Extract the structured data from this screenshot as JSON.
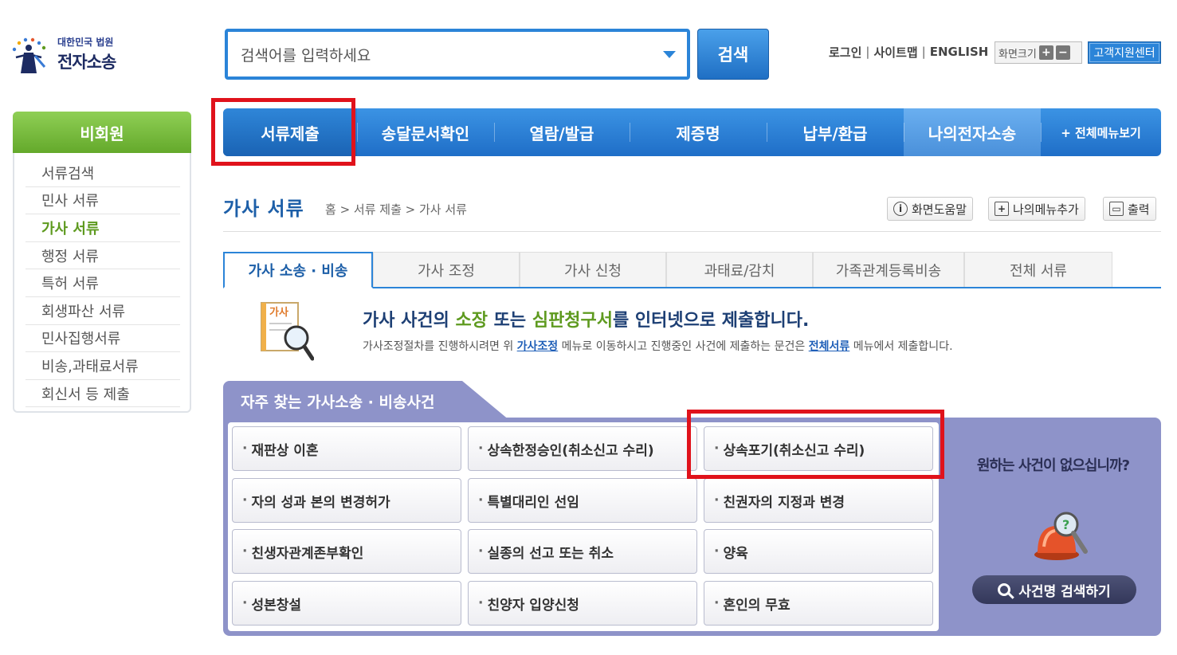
{
  "logo": {
    "sub": "대한민국 법원",
    "main": "전자소송"
  },
  "search": {
    "placeholder": "검색어를 입력하세요",
    "button": "검색"
  },
  "util": {
    "login": "로그인",
    "sitemap": "사이트맵",
    "english": "ENGLISH",
    "zoom": "화면크기",
    "zoom_in": "+",
    "zoom_out": "−",
    "support": "고객지원센터"
  },
  "sidebar": {
    "header": "비회원",
    "items": [
      {
        "label": "서류검색"
      },
      {
        "label": "민사 서류"
      },
      {
        "label": "가사 서류"
      },
      {
        "label": "행정 서류"
      },
      {
        "label": "특허 서류"
      },
      {
        "label": "회생파산 서류"
      },
      {
        "label": "민사집행서류"
      },
      {
        "label": "비송,과태료서류"
      },
      {
        "label": "회신서 등 제출"
      }
    ],
    "active_index": 2
  },
  "gnb": {
    "items": [
      {
        "label": "서류제출"
      },
      {
        "label": "송달문서확인"
      },
      {
        "label": "열람/발급"
      },
      {
        "label": "제증명"
      },
      {
        "label": "납부/환급"
      },
      {
        "label": "나의전자소송"
      },
      {
        "label": "+ 전체메뉴보기"
      }
    ]
  },
  "page": {
    "title": "가사 서류",
    "breadcrumb": "홈 > 서류 제출 > 가사 서류",
    "help": "화면도움말",
    "add_menu": "나의메뉴추가",
    "print": "출력"
  },
  "tabs": [
    {
      "label": "가사 소송 · 비송"
    },
    {
      "label": "가사 조정"
    },
    {
      "label": "가사 신청"
    },
    {
      "label": "과태료/감치"
    },
    {
      "label": "가족관계등록비송"
    },
    {
      "label": "전체 서류"
    }
  ],
  "intro": {
    "icon_label": "가사",
    "title_1": "가사 사건의 ",
    "title_2": "소장",
    "title_3": " 또는 ",
    "title_4": "심판청구서",
    "title_5": "를 인터넷으로 제출합니다.",
    "desc_1": "가사조정절차를 진행하시려면 위 ",
    "desc_link1": "가사조정",
    "desc_2": " 메뉴로 이동하시고 진행중인 사건에 제출하는 문건은 ",
    "desc_link2": "전체서류",
    "desc_3": " 메뉴에서 제출합니다."
  },
  "frequent": {
    "title": "자주 찾는 가사소송 · 비송사건",
    "items": [
      {
        "label": "재판상 이혼"
      },
      {
        "label": "상속한정승인(취소신고 수리)"
      },
      {
        "label": "상속포기(취소신고 수리)"
      },
      {
        "label": "자의 성과 본의 변경허가"
      },
      {
        "label": "특별대리인 선임"
      },
      {
        "label": "친권자의 지정과 변경"
      },
      {
        "label": "친생자관계존부확인"
      },
      {
        "label": "실종의 선고 또는 취소"
      },
      {
        "label": "양육"
      },
      {
        "label": "성본창설"
      },
      {
        "label": "친양자 입양신청"
      },
      {
        "label": "혼인의 무효"
      }
    ],
    "no_case": "원하는 사건이 없으십니까?",
    "search_button": "사건명 검색하기"
  },
  "colors": {
    "accent": "#2b84d8",
    "green": "#64a92b",
    "highlight": "#e0121b",
    "panel": "#8e93c9"
  }
}
